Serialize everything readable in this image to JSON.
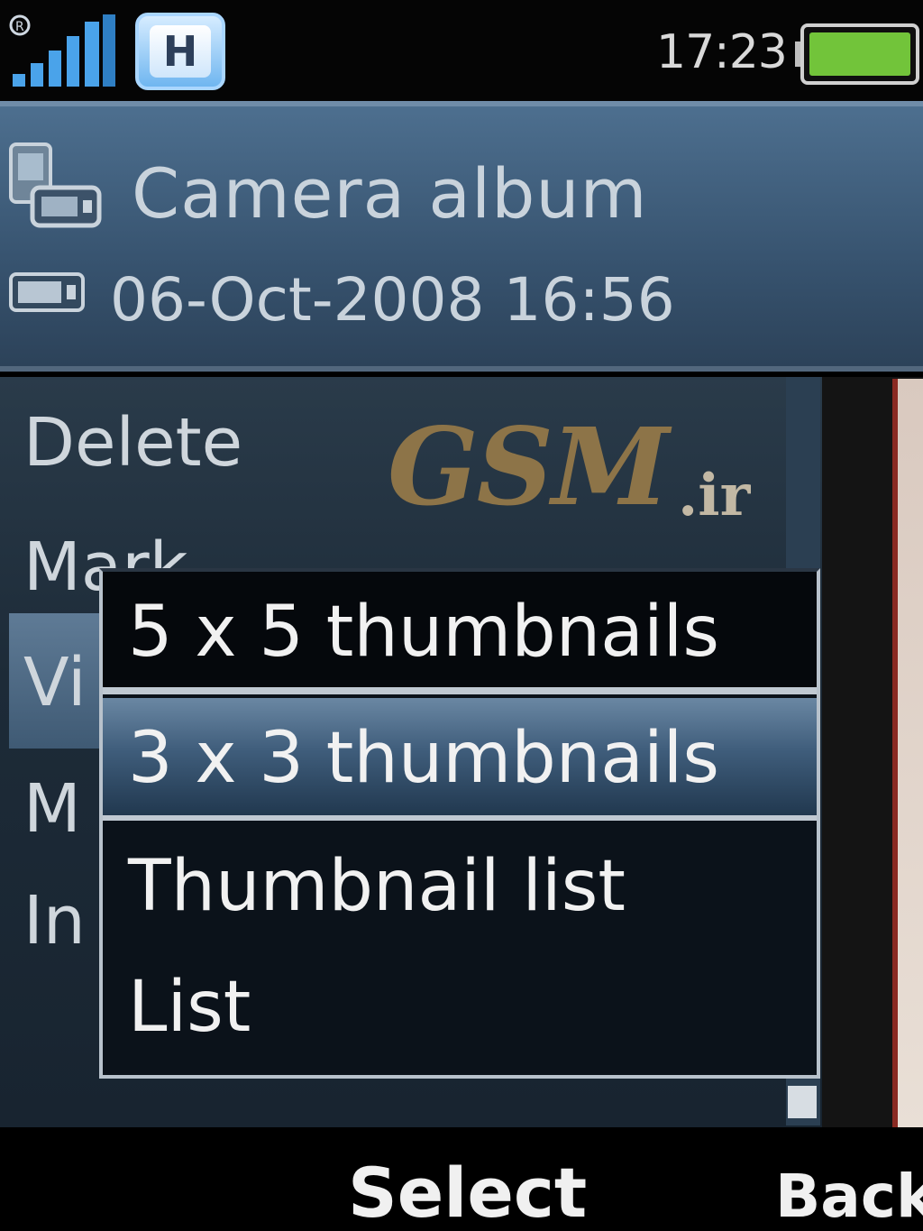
{
  "status_bar": {
    "network_type": "H",
    "time": "17:23",
    "battery_level": 1.0
  },
  "header": {
    "title": "Camera album",
    "datetime": "06-Oct-2008 16:56"
  },
  "options_menu": {
    "items": [
      {
        "label": "Delete"
      },
      {
        "label": "Mark"
      },
      {
        "label": "Vi"
      },
      {
        "label": "M"
      },
      {
        "label": "In"
      }
    ],
    "highlighted_index": 2
  },
  "view_submenu": {
    "items": [
      {
        "label": "5 x 5 thumbnails"
      },
      {
        "label": "3 x 3 thumbnails"
      },
      {
        "label": "Thumbnail list"
      },
      {
        "label": "List"
      }
    ],
    "selected_index": 1
  },
  "watermark": {
    "brand": "GSM",
    "suffix": ".ir"
  },
  "softkeys": {
    "center": "Select",
    "right": "Back"
  }
}
